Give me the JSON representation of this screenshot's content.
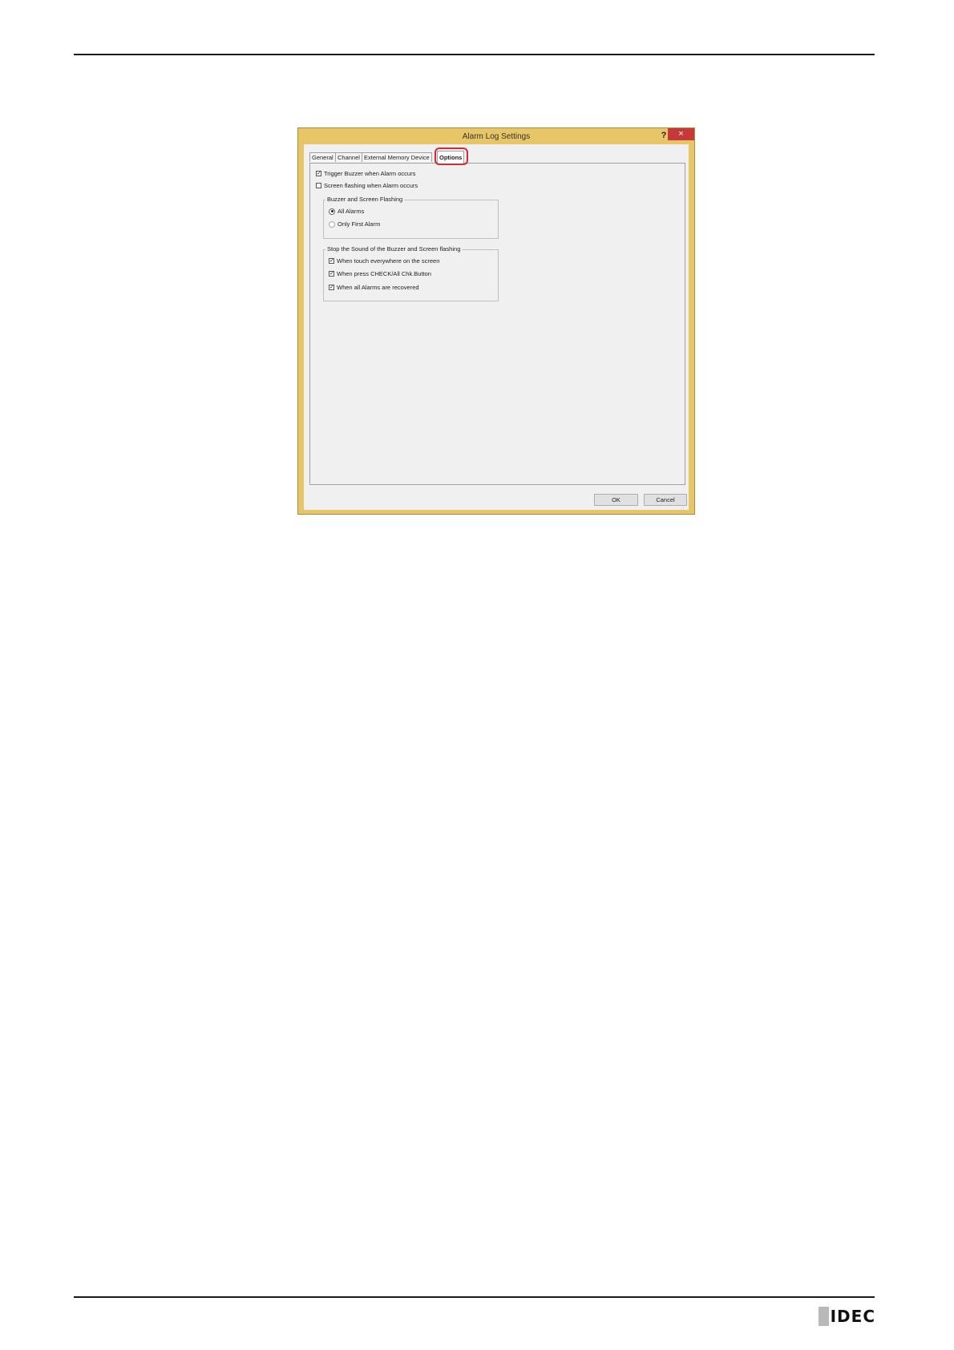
{
  "dialog": {
    "title": "Alarm Log Settings",
    "help_glyph": "?",
    "close_glyph": "×",
    "tabs": [
      {
        "label": "General"
      },
      {
        "label": "Channel"
      },
      {
        "label": "External Memory Device"
      },
      {
        "label": "Options"
      }
    ],
    "active_tab": "Options",
    "options": {
      "trigger_buzzer": {
        "label": "Trigger Buzzer when Alarm occurs",
        "checked": true
      },
      "screen_flashing": {
        "label": "Screen flashing when Alarm occurs",
        "checked": false
      },
      "buzzer_group": {
        "title": "Buzzer and Screen Flashing",
        "radios": [
          {
            "label": "All Alarms",
            "selected": true
          },
          {
            "label": "Only First Alarm",
            "selected": false
          }
        ]
      },
      "stop_group": {
        "title": "Stop the Sound of the Buzzer and Screen flashing",
        "checks": [
          {
            "label": "When touch everywhere on the screen",
            "checked": true
          },
          {
            "label": "When press CHECK/All Chk.Button",
            "checked": true
          },
          {
            "label": "When all Alarms are recovered",
            "checked": true
          }
        ]
      }
    },
    "buttons": {
      "ok": "OK",
      "cancel": "Cancel"
    },
    "check_glyph": "✓"
  },
  "footer": {
    "logo_text": "IDEC"
  }
}
